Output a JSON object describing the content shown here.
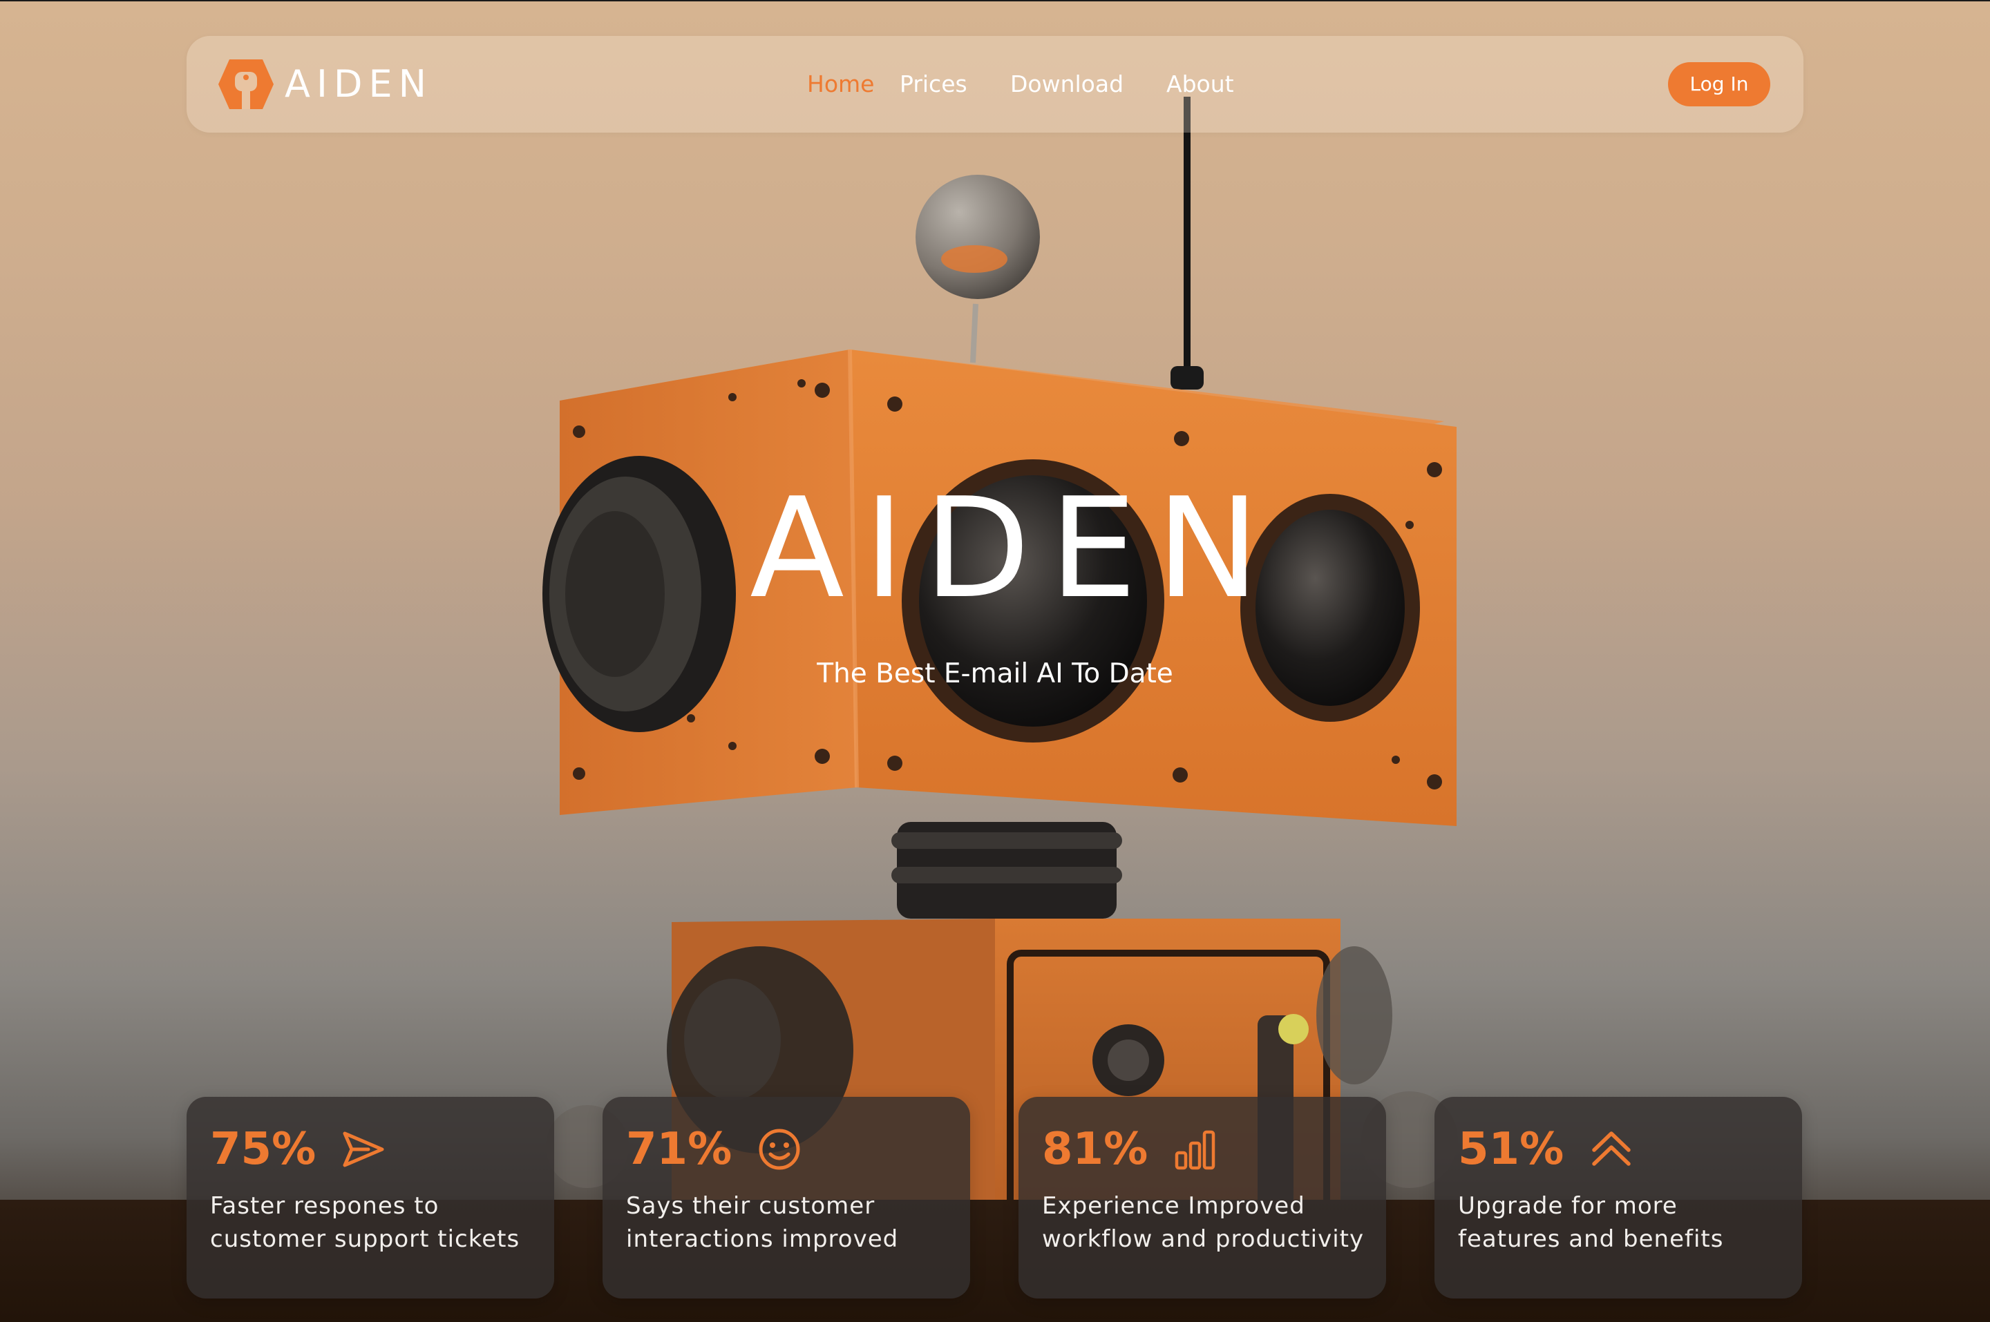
{
  "brand": {
    "name": "AIDEN",
    "accent": "#ee7a31"
  },
  "nav": {
    "links": [
      {
        "label": "Home",
        "active": true
      },
      {
        "label": "Prices",
        "active": false
      },
      {
        "label": "Download",
        "active": false
      },
      {
        "label": "About",
        "active": false
      }
    ],
    "login_label": "Log In"
  },
  "hero": {
    "title": "AIDEN",
    "subtitle": "The Best E-mail AI To Date"
  },
  "stats": [
    {
      "value": "75%",
      "icon": "send-icon",
      "description_lines": [
        "Faster respones to",
        "customer support tickets"
      ]
    },
    {
      "value": "71%",
      "icon": "smiley-icon",
      "description_lines": [
        "Says their customer",
        "interactions improved"
      ]
    },
    {
      "value": "81%",
      "icon": "bar-chart-icon",
      "description_lines": [
        "Experience Improved",
        "workflow and productivity"
      ]
    },
    {
      "value": "51%",
      "icon": "double-chevron-up-icon",
      "description_lines": [
        "Upgrade for more",
        "features and benefits"
      ]
    }
  ]
}
